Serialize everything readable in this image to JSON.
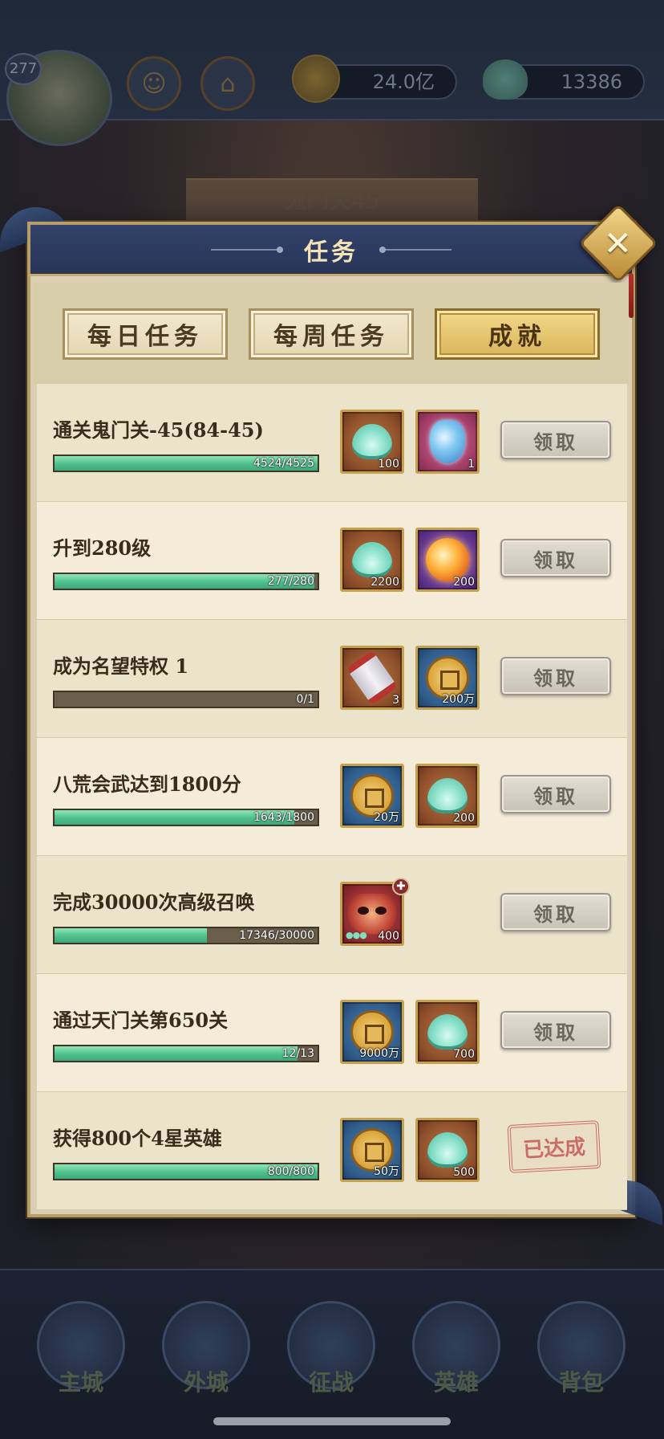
{
  "background": {
    "level": "277",
    "gold_amount": "24.0亿",
    "shell_amount": "13386",
    "stage_name": "鬼门关45",
    "nav": [
      "主城",
      "外城",
      "征战",
      "英雄",
      "背包"
    ]
  },
  "panel": {
    "title": "任务",
    "close_icon": "✕"
  },
  "tabs": [
    {
      "label": "每日任务",
      "active": false
    },
    {
      "label": "每周任务",
      "active": false
    },
    {
      "label": "成就",
      "active": true
    }
  ],
  "tasks": [
    {
      "title": "通关鬼门关-45(84-45)",
      "progress_text": "4524/4525",
      "progress": 0.9998,
      "rewards": [
        {
          "icon": "shell-icon",
          "count": "100"
        },
        {
          "icon": "jade-pendant-icon",
          "count": "1"
        }
      ],
      "action": "领取"
    },
    {
      "title": "升到280级",
      "progress_text": "277/280",
      "progress": 0.989,
      "rewards": [
        {
          "icon": "shell-icon",
          "count": "2200"
        },
        {
          "icon": "fire-orb-icon",
          "count": "200"
        }
      ],
      "action": "领取"
    },
    {
      "title": "成为名望特权 1",
      "progress_text": "0/1",
      "progress": 0,
      "rewards": [
        {
          "icon": "scroll-icon",
          "count": "3"
        },
        {
          "icon": "coin-icon",
          "count": "200万"
        }
      ],
      "action": "领取"
    },
    {
      "title": "八荒会武达到1800分",
      "progress_text": "1643/1800",
      "progress": 0.913,
      "rewards": [
        {
          "icon": "coin-icon",
          "count": "20万"
        },
        {
          "icon": "shell-icon",
          "count": "200"
        }
      ],
      "action": "领取"
    },
    {
      "title": "完成30000次高级召唤",
      "progress_text": "17346/30000",
      "progress": 0.578,
      "rewards": [
        {
          "icon": "opera-mask-icon",
          "count": "400"
        }
      ],
      "action": "领取"
    },
    {
      "title": "通过天门关第650关",
      "progress_text": "12/13",
      "progress": 0.923,
      "rewards": [
        {
          "icon": "coin-icon",
          "count": "9000万"
        },
        {
          "icon": "shell-icon",
          "count": "700"
        }
      ],
      "action": "领取"
    },
    {
      "title": "获得800个4星英雄",
      "progress_text": "800/800",
      "progress": 1,
      "rewards": [
        {
          "icon": "coin-icon",
          "count": "50万"
        },
        {
          "icon": "shell-icon",
          "count": "500"
        }
      ],
      "stamp": "已达成"
    }
  ],
  "colors": {
    "panel_bg": "#d9cfb3",
    "header_blue": "#2c3a60",
    "progress_green": "#4fc08c",
    "gold_border": "#c7a24e",
    "stamp_red": "#c45a56"
  }
}
